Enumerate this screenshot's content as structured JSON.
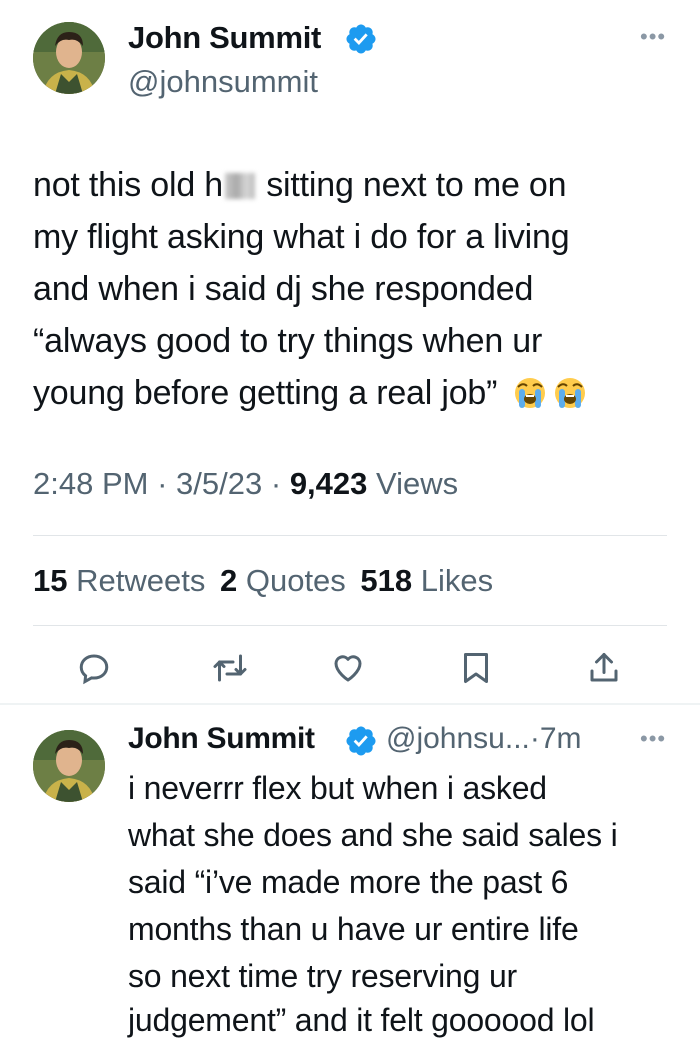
{
  "tweet": {
    "author_name": "John Summit",
    "author_handle": "@johnsummit",
    "text_lines": [
      [
        "not this old h",
        " sitting next to me on"
      ],
      "my flight asking what i do for a living",
      "and when i said dj she responded",
      "“always good to try things when ur",
      "young before getting a real job”"
    ],
    "time": "2:48 PM",
    "sep1": "·",
    "date": "3/5/23",
    "sep2": "·",
    "views_count": "9,423",
    "views_label": "Views",
    "retweets_count": "15",
    "retweets_label": "Retweets",
    "quotes_count": "2",
    "quotes_label": "Quotes",
    "likes_count": "518",
    "likes_label": "Likes",
    "emoji": [
      "loudly-crying-face",
      "loudly-crying-face"
    ]
  },
  "reply": {
    "author_name": "John Summit",
    "author_handle_short": "@johnsu...",
    "sep": "·",
    "age": "7m",
    "text_lines": [
      "i neverrr flex but when i asked",
      "what she does and she said sales i",
      "said “i’ve made more the past 6",
      "months than u have ur entire life",
      "so next time try reserving ur",
      "judgement” and it felt goooood lol"
    ]
  },
  "icons": {
    "more": "more-horizontal-icon",
    "verified": "verified-badge-icon",
    "actions": [
      "reply-icon",
      "retweet-icon",
      "like-icon",
      "bookmark-icon",
      "share-icon"
    ]
  },
  "colors": {
    "verified": "#1d9bf0",
    "secondary_text": "#536471",
    "primary_text": "#0f1419",
    "divider": "#e1e5e8"
  }
}
